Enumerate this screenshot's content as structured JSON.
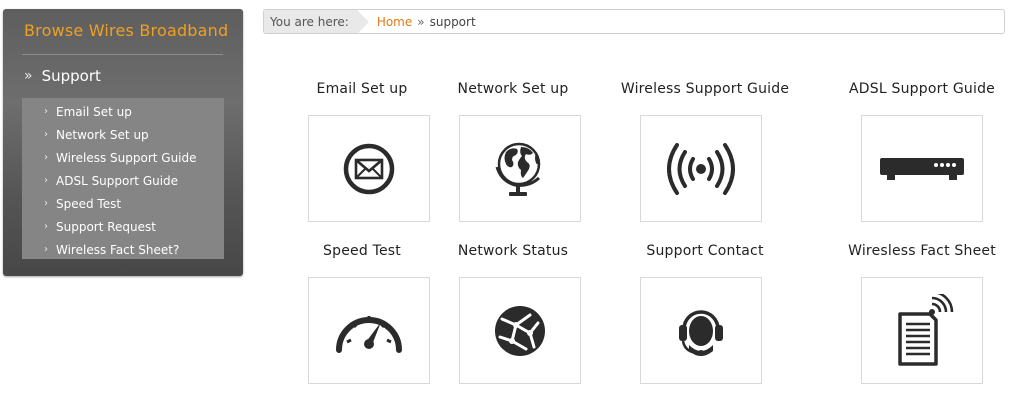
{
  "sidebar": {
    "title": "Browse Wires Broadband",
    "section_label": "Support",
    "items": [
      {
        "label": "Email Set up"
      },
      {
        "label": "Network Set up"
      },
      {
        "label": "Wireless Support Guide"
      },
      {
        "label": "ADSL Support Guide"
      },
      {
        "label": "Speed Test"
      },
      {
        "label": "Support Request"
      },
      {
        "label": "Wireless Fact Sheet?"
      }
    ]
  },
  "breadcrumb": {
    "lead": "You are here:",
    "home": "Home",
    "separator": "»",
    "current": "support"
  },
  "tiles": [
    {
      "label": "Email Set up",
      "icon": "envelope-icon"
    },
    {
      "label": "Network Set up",
      "icon": "globe-icon"
    },
    {
      "label": "Wireless Support Guide",
      "icon": "wireless-signal-icon"
    },
    {
      "label": "ADSL Support Guide",
      "icon": "modem-icon"
    },
    {
      "label": "Speed Test",
      "icon": "speedometer-icon"
    },
    {
      "label": "Network Status",
      "icon": "network-globe-icon"
    },
    {
      "label": "Support Contact",
      "icon": "headset-icon"
    },
    {
      "label": "Wiresless Fact Sheet",
      "icon": "document-wireless-icon"
    }
  ],
  "colors": {
    "accent": "#f0a020",
    "link": "#e07a1a",
    "icon": "#2b2b2b"
  }
}
